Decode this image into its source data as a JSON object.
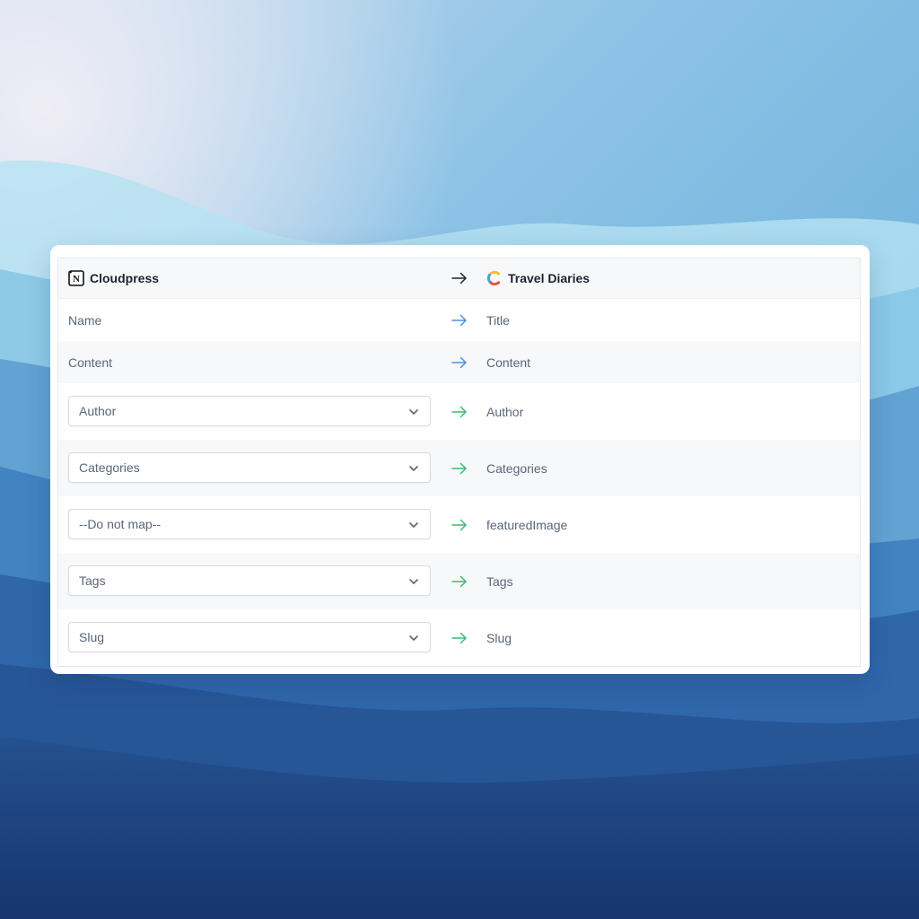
{
  "colors": {
    "mapped_arrow": "#4f8fe0",
    "select_arrow": "#3dba73",
    "header_arrow": "#1c2330"
  },
  "header": {
    "source_name": "Cloudpress",
    "source_icon": "notion-logo-icon",
    "target_name": "Travel Diaries",
    "target_icon": "contentful-logo-icon"
  },
  "fixed_mappings": [
    {
      "source": "Name",
      "target": "Title"
    },
    {
      "source": "Content",
      "target": "Content"
    }
  ],
  "select_mappings": [
    {
      "selected": "Author",
      "target": "Author"
    },
    {
      "selected": "Categories",
      "target": "Categories"
    },
    {
      "selected": "--Do not map--",
      "target": "featuredImage"
    },
    {
      "selected": "Tags",
      "target": "Tags"
    },
    {
      "selected": "Slug",
      "target": "Slug"
    }
  ]
}
